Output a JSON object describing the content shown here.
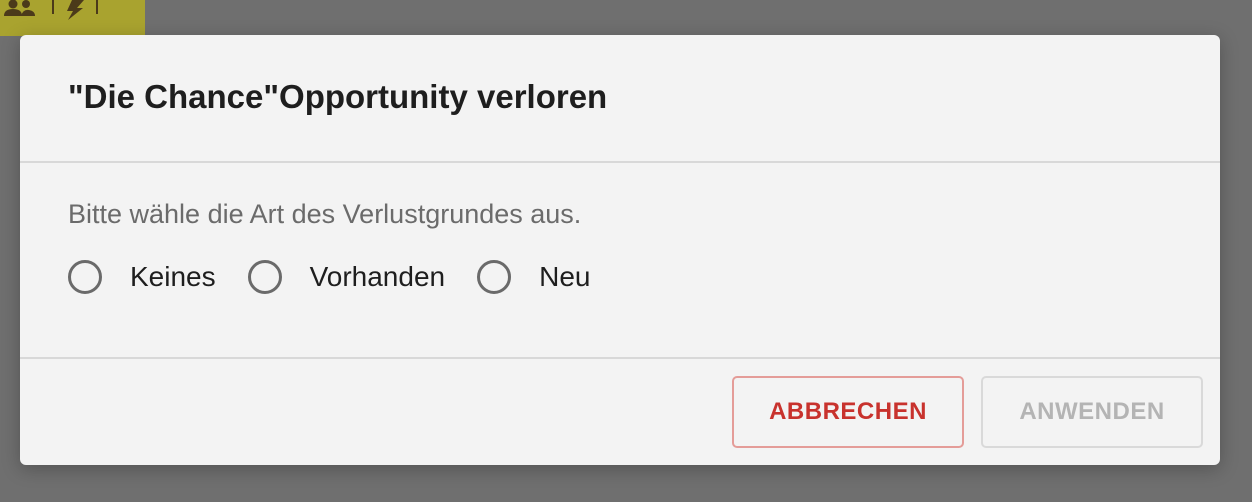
{
  "background": {
    "toolbar_icons": [
      "users-icon",
      "lightning-icon"
    ],
    "colors": {
      "overlay": "#6f6f6f",
      "toolbar": "#a9a32f"
    }
  },
  "dialog": {
    "title": "\"Die Chance\"Opportunity verloren",
    "prompt": "Bitte wähle die Art des Verlustgrundes aus.",
    "options": [
      {
        "label": "Keines",
        "selected": false
      },
      {
        "label": "Vorhanden",
        "selected": false
      },
      {
        "label": "Neu",
        "selected": false
      }
    ],
    "buttons": {
      "cancel_label": "ABBRECHEN",
      "apply_label": "ANWENDEN",
      "apply_enabled": false
    },
    "colors": {
      "surface": "#f3f3f3",
      "cancel_text": "#c8322d",
      "cancel_border": "#e49c98",
      "disabled_text": "#b4b4b4"
    }
  }
}
